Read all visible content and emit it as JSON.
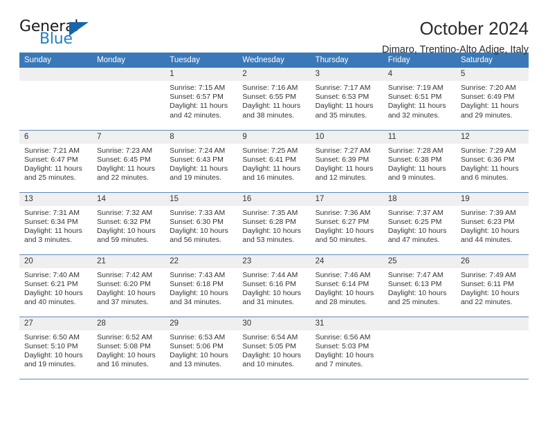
{
  "brand": {
    "name_top": "General",
    "name_bottom": "Blue",
    "accent_color": "#1f7fc4",
    "triangle_color": "#1566ab"
  },
  "header": {
    "title": "October 2024",
    "subtitle": "Dimaro, Trentino-Alto Adige, Italy"
  },
  "theme": {
    "header_blue": "#3b78b8",
    "daynum_band": "#efefef",
    "row_rule": "#5d87b5"
  },
  "weekday_headers": [
    "Sunday",
    "Monday",
    "Tuesday",
    "Wednesday",
    "Thursday",
    "Friday",
    "Saturday"
  ],
  "weeks": [
    [
      {
        "day": "",
        "lines": []
      },
      {
        "day": "",
        "lines": []
      },
      {
        "day": "1",
        "lines": [
          "Sunrise: 7:15 AM",
          "Sunset: 6:57 PM",
          "Daylight: 11 hours",
          "and 42 minutes."
        ]
      },
      {
        "day": "2",
        "lines": [
          "Sunrise: 7:16 AM",
          "Sunset: 6:55 PM",
          "Daylight: 11 hours",
          "and 38 minutes."
        ]
      },
      {
        "day": "3",
        "lines": [
          "Sunrise: 7:17 AM",
          "Sunset: 6:53 PM",
          "Daylight: 11 hours",
          "and 35 minutes."
        ]
      },
      {
        "day": "4",
        "lines": [
          "Sunrise: 7:19 AM",
          "Sunset: 6:51 PM",
          "Daylight: 11 hours",
          "and 32 minutes."
        ]
      },
      {
        "day": "5",
        "lines": [
          "Sunrise: 7:20 AM",
          "Sunset: 6:49 PM",
          "Daylight: 11 hours",
          "and 29 minutes."
        ]
      }
    ],
    [
      {
        "day": "6",
        "lines": [
          "Sunrise: 7:21 AM",
          "Sunset: 6:47 PM",
          "Daylight: 11 hours",
          "and 25 minutes."
        ]
      },
      {
        "day": "7",
        "lines": [
          "Sunrise: 7:23 AM",
          "Sunset: 6:45 PM",
          "Daylight: 11 hours",
          "and 22 minutes."
        ]
      },
      {
        "day": "8",
        "lines": [
          "Sunrise: 7:24 AM",
          "Sunset: 6:43 PM",
          "Daylight: 11 hours",
          "and 19 minutes."
        ]
      },
      {
        "day": "9",
        "lines": [
          "Sunrise: 7:25 AM",
          "Sunset: 6:41 PM",
          "Daylight: 11 hours",
          "and 16 minutes."
        ]
      },
      {
        "day": "10",
        "lines": [
          "Sunrise: 7:27 AM",
          "Sunset: 6:39 PM",
          "Daylight: 11 hours",
          "and 12 minutes."
        ]
      },
      {
        "day": "11",
        "lines": [
          "Sunrise: 7:28 AM",
          "Sunset: 6:38 PM",
          "Daylight: 11 hours",
          "and 9 minutes."
        ]
      },
      {
        "day": "12",
        "lines": [
          "Sunrise: 7:29 AM",
          "Sunset: 6:36 PM",
          "Daylight: 11 hours",
          "and 6 minutes."
        ]
      }
    ],
    [
      {
        "day": "13",
        "lines": [
          "Sunrise: 7:31 AM",
          "Sunset: 6:34 PM",
          "Daylight: 11 hours",
          "and 3 minutes."
        ]
      },
      {
        "day": "14",
        "lines": [
          "Sunrise: 7:32 AM",
          "Sunset: 6:32 PM",
          "Daylight: 10 hours",
          "and 59 minutes."
        ]
      },
      {
        "day": "15",
        "lines": [
          "Sunrise: 7:33 AM",
          "Sunset: 6:30 PM",
          "Daylight: 10 hours",
          "and 56 minutes."
        ]
      },
      {
        "day": "16",
        "lines": [
          "Sunrise: 7:35 AM",
          "Sunset: 6:28 PM",
          "Daylight: 10 hours",
          "and 53 minutes."
        ]
      },
      {
        "day": "17",
        "lines": [
          "Sunrise: 7:36 AM",
          "Sunset: 6:27 PM",
          "Daylight: 10 hours",
          "and 50 minutes."
        ]
      },
      {
        "day": "18",
        "lines": [
          "Sunrise: 7:37 AM",
          "Sunset: 6:25 PM",
          "Daylight: 10 hours",
          "and 47 minutes."
        ]
      },
      {
        "day": "19",
        "lines": [
          "Sunrise: 7:39 AM",
          "Sunset: 6:23 PM",
          "Daylight: 10 hours",
          "and 44 minutes."
        ]
      }
    ],
    [
      {
        "day": "20",
        "lines": [
          "Sunrise: 7:40 AM",
          "Sunset: 6:21 PM",
          "Daylight: 10 hours",
          "and 40 minutes."
        ]
      },
      {
        "day": "21",
        "lines": [
          "Sunrise: 7:42 AM",
          "Sunset: 6:20 PM",
          "Daylight: 10 hours",
          "and 37 minutes."
        ]
      },
      {
        "day": "22",
        "lines": [
          "Sunrise: 7:43 AM",
          "Sunset: 6:18 PM",
          "Daylight: 10 hours",
          "and 34 minutes."
        ]
      },
      {
        "day": "23",
        "lines": [
          "Sunrise: 7:44 AM",
          "Sunset: 6:16 PM",
          "Daylight: 10 hours",
          "and 31 minutes."
        ]
      },
      {
        "day": "24",
        "lines": [
          "Sunrise: 7:46 AM",
          "Sunset: 6:14 PM",
          "Daylight: 10 hours",
          "and 28 minutes."
        ]
      },
      {
        "day": "25",
        "lines": [
          "Sunrise: 7:47 AM",
          "Sunset: 6:13 PM",
          "Daylight: 10 hours",
          "and 25 minutes."
        ]
      },
      {
        "day": "26",
        "lines": [
          "Sunrise: 7:49 AM",
          "Sunset: 6:11 PM",
          "Daylight: 10 hours",
          "and 22 minutes."
        ]
      }
    ],
    [
      {
        "day": "27",
        "lines": [
          "Sunrise: 6:50 AM",
          "Sunset: 5:10 PM",
          "Daylight: 10 hours",
          "and 19 minutes."
        ]
      },
      {
        "day": "28",
        "lines": [
          "Sunrise: 6:52 AM",
          "Sunset: 5:08 PM",
          "Daylight: 10 hours",
          "and 16 minutes."
        ]
      },
      {
        "day": "29",
        "lines": [
          "Sunrise: 6:53 AM",
          "Sunset: 5:06 PM",
          "Daylight: 10 hours",
          "and 13 minutes."
        ]
      },
      {
        "day": "30",
        "lines": [
          "Sunrise: 6:54 AM",
          "Sunset: 5:05 PM",
          "Daylight: 10 hours",
          "and 10 minutes."
        ]
      },
      {
        "day": "31",
        "lines": [
          "Sunrise: 6:56 AM",
          "Sunset: 5:03 PM",
          "Daylight: 10 hours",
          "and 7 minutes."
        ]
      },
      {
        "day": "",
        "lines": []
      },
      {
        "day": "",
        "lines": []
      }
    ]
  ]
}
